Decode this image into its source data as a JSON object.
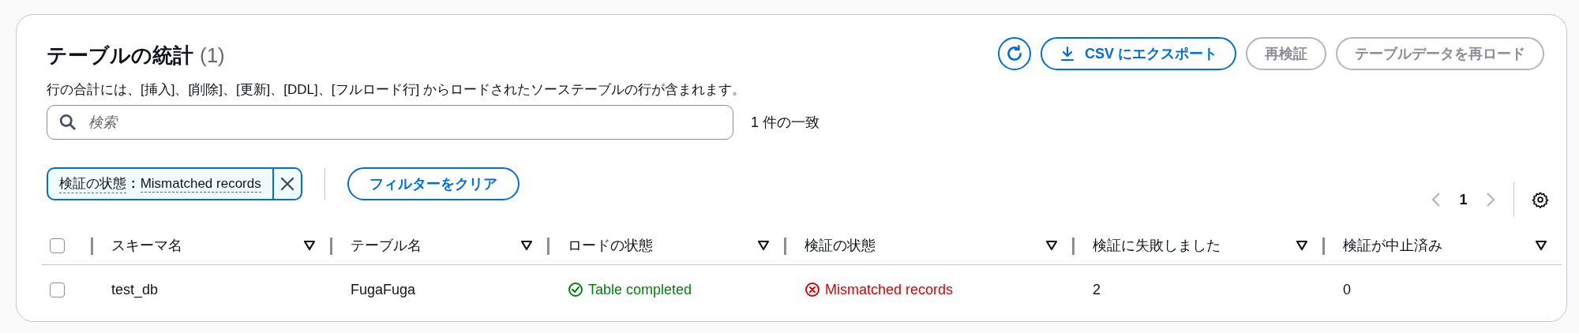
{
  "header": {
    "title": "テーブルの統計",
    "count": "(1)",
    "description": "行の合計には、[挿入]、[削除]、[更新]、[DDL]、[フルロード行] からロードされたソーステーブルの行が含まれます。"
  },
  "actions": [
    {
      "kind": "refresh",
      "disabled": false
    },
    {
      "kind": "export",
      "label": "CSV にエクスポート",
      "disabled": false
    },
    {
      "kind": "plain",
      "label": "再検証",
      "disabled": true
    },
    {
      "kind": "plain",
      "label": "テーブルデータを再ロード",
      "disabled": true
    }
  ],
  "search": {
    "placeholder": "検索",
    "match_count": "1 件の一致"
  },
  "filter_token": {
    "property": "検証の状態",
    "separator": ":",
    "value": "Mismatched records"
  },
  "clear_filters": "フィルターをクリア",
  "pagination": {
    "page": "1",
    "prev_disabled": true,
    "next_disabled": true
  },
  "table": {
    "select_all_checked": false,
    "columns": [
      "スキーマ名",
      "テーブル名",
      "ロードの状態",
      "検証の状態",
      "検証に失敗しました",
      "検証が中止済み"
    ],
    "rows": [
      {
        "checked": false,
        "cells": [
          {
            "kind": "text",
            "text": "test_db"
          },
          {
            "kind": "text",
            "text": "FugaFuga"
          },
          {
            "kind": "success",
            "text": "Table completed"
          },
          {
            "kind": "error",
            "text": "Mismatched records"
          },
          {
            "kind": "text",
            "text": "2"
          },
          {
            "kind": "text",
            "text": "0"
          }
        ]
      }
    ]
  }
}
